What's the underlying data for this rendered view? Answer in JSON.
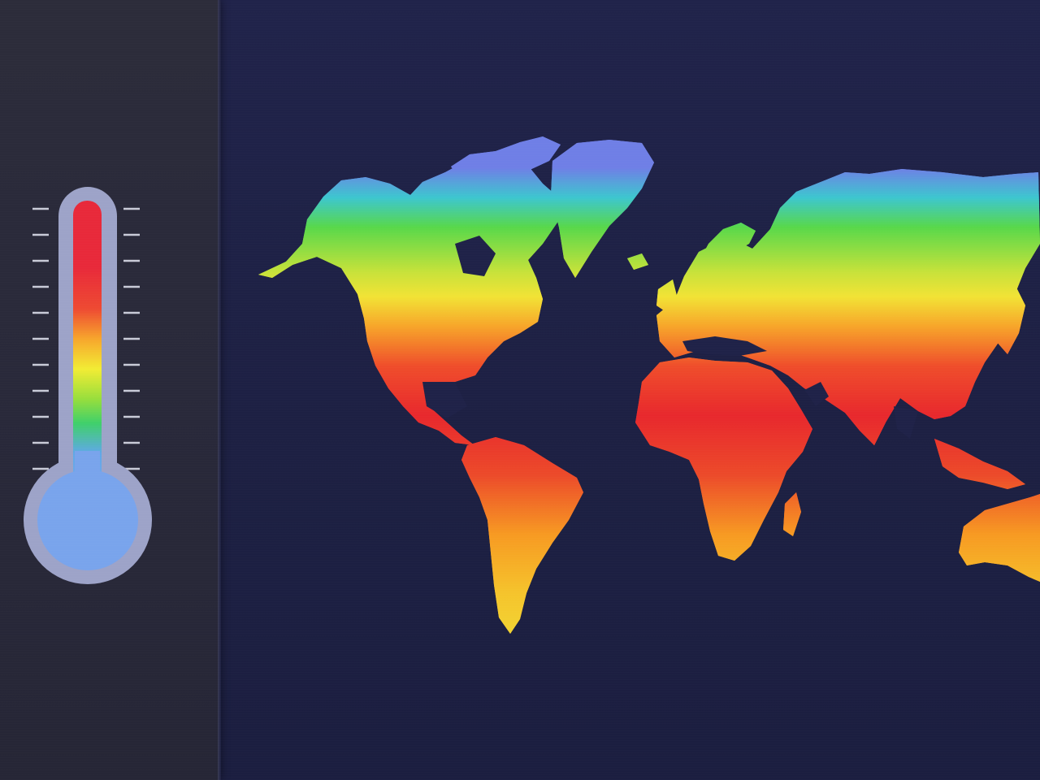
{
  "thermometer": {
    "icon": "thermometer-icon",
    "tick_count": 11,
    "tube_colors": [
      "#e8293a",
      "#ee4a32",
      "#f7a62c",
      "#f2ec34",
      "#97de3c",
      "#3fd06a",
      "#5fa8e8",
      "#7fa6ec"
    ],
    "bulb_color": "#79a4ec",
    "frame_color": "#9da3c8",
    "tick_color": "#c9cbd8"
  },
  "map": {
    "icon": "world-map-icon",
    "gradient": [
      {
        "stop": "cold",
        "color": "#6f7fe6"
      },
      {
        "stop": "cool",
        "color": "#3dc6cf"
      },
      {
        "stop": "mild",
        "color": "#58d84a"
      },
      {
        "stop": "warm",
        "color": "#f2e335"
      },
      {
        "stop": "hot",
        "color": "#f7941f"
      },
      {
        "stop": "hottest",
        "color": "#e8282d"
      }
    ],
    "ocean_color": "#1f2248",
    "pattern": "triangle-mosaic"
  },
  "colors": {
    "panel": "#2a2a39",
    "background": "#1e2146"
  }
}
